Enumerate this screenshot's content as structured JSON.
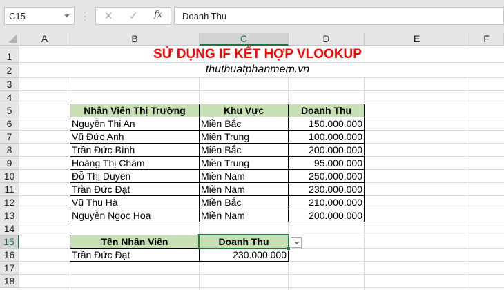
{
  "formula_bar": {
    "name_box": "C15",
    "content": "Doanh Thu",
    "cancel": "✕",
    "enter": "✓",
    "fx": "fx"
  },
  "columns": [
    "A",
    "B",
    "C",
    "D",
    "E",
    "F"
  ],
  "rows": [
    "1",
    "2",
    "3",
    "4",
    "5",
    "6",
    "7",
    "8",
    "9",
    "10",
    "11",
    "12",
    "13",
    "14",
    "15",
    "16",
    "17",
    "18"
  ],
  "title": "SỬ DỤNG IF KẾT HỢP VLOOKUP",
  "subtitle": "thuthuatphanmem.vn",
  "table": {
    "headers": [
      "Nhân Viên Thị Trường",
      "Khu Vực",
      "Doanh Thu"
    ],
    "rows": [
      [
        "Nguyễn Thị An",
        "Miền Bắc",
        "150.000.000"
      ],
      [
        "Vũ Đức Anh",
        "Miền Trung",
        "100.000.000"
      ],
      [
        "Trần Đức Bình",
        "Miền Bắc",
        "200.000.000"
      ],
      [
        "Hoàng Thị Châm",
        "Miền Trung",
        "95.000.000"
      ],
      [
        "Đỗ Thị Duyên",
        "Miền Nam",
        "250.000.000"
      ],
      [
        "Trần Đức Đạt",
        "Miền Nam",
        "230.000.000"
      ],
      [
        "Vũ Thu Hà",
        "Miền Bắc",
        "210.000.000"
      ],
      [
        "Nguyễn Ngọc Hoa",
        "Miền Nam",
        "200.000.000"
      ]
    ]
  },
  "lookup": {
    "headers": [
      "Tên Nhân Viên",
      "Doanh Thu"
    ],
    "name": "Trần Đức Đạt",
    "value": "230.000.000"
  }
}
